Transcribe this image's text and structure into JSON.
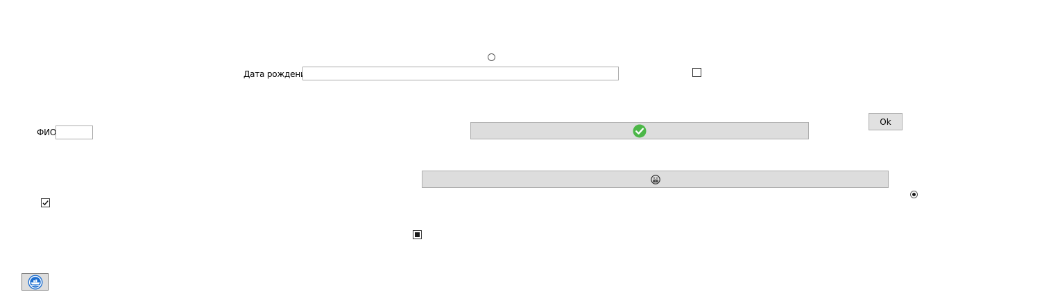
{
  "form": {
    "birth_date_label": "Дата рождения",
    "birth_date_value": "",
    "full_name_label": "ФИО",
    "full_name_value": "",
    "ok_label": "Ok"
  },
  "controls": {
    "radio_top_selected": false,
    "radio_right_selected": true,
    "checkbox_top_checked": false,
    "checkbox_left_checked": true,
    "checkbox_center_state": "indeterminate"
  },
  "icons": {
    "wide_button_top": "green-checkmark-icon",
    "wide_button_bottom": "grimace-emoji-icon",
    "corner_button": "ship-logo-icon"
  },
  "colors": {
    "button_face": "#dddddd",
    "textbox_border": "#ababab",
    "check_green": "#4cb748",
    "logo_blue": "#1e6fd0"
  }
}
